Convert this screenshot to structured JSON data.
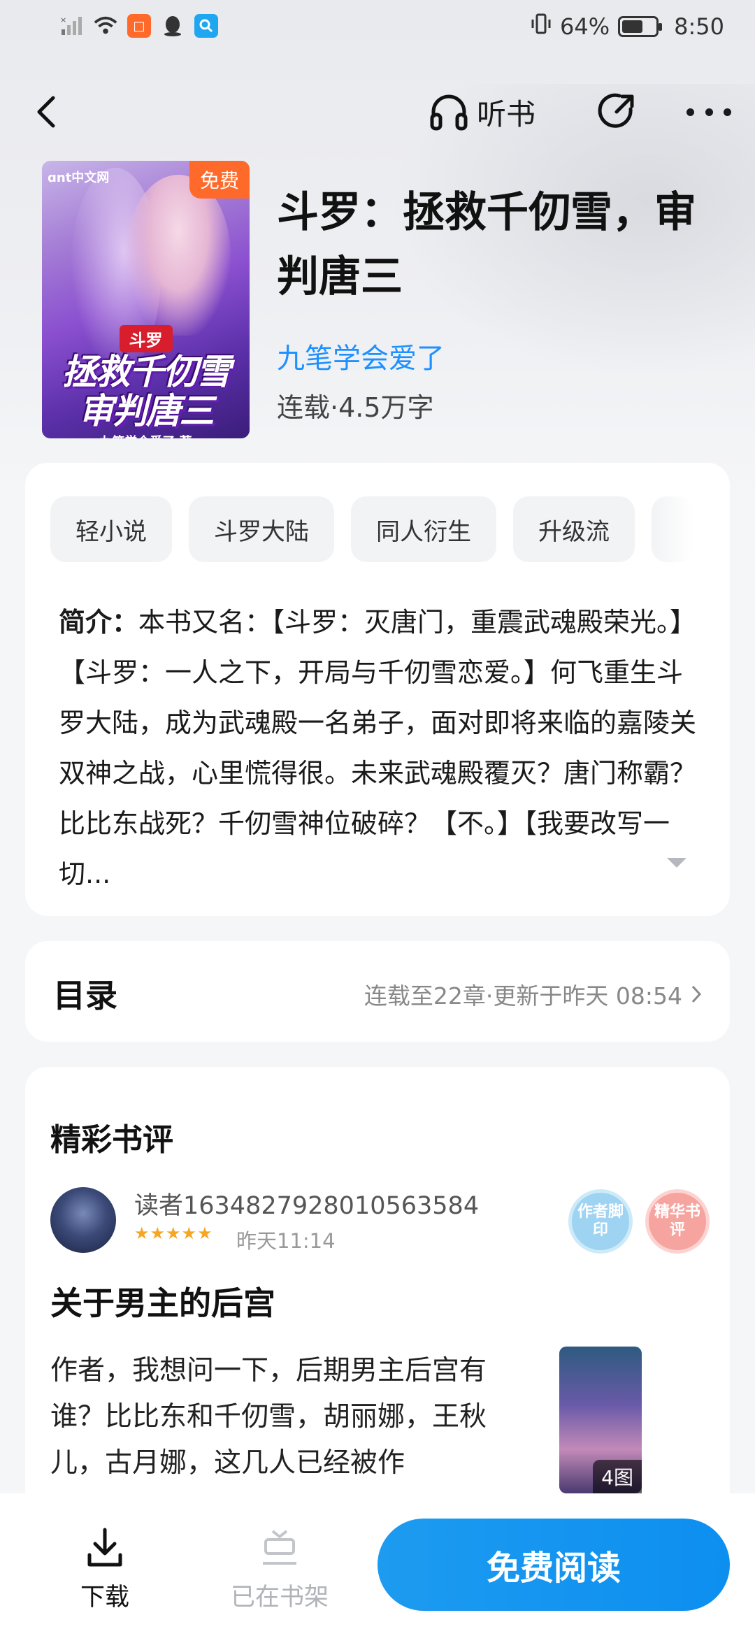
{
  "status_bar": {
    "battery_percent": "64%",
    "battery_level": 0.64,
    "time": "8:50",
    "icons": [
      "signal-icon",
      "wifi-icon",
      "app-notification-icon",
      "qq-icon",
      "search-app-icon",
      "vibrate-icon",
      "battery-icon"
    ]
  },
  "nav": {
    "listen_label": "听书",
    "icons": [
      "back-icon",
      "headphones-icon",
      "share-icon",
      "more-icon"
    ]
  },
  "book": {
    "cover": {
      "free_badge": "免费",
      "publisher": "ɑnt中文网",
      "tag": "斗罗",
      "line1": "拯救千仞雪",
      "line2": "审判唐三",
      "author_line": "九笔学会爱了 著"
    },
    "title": "斗罗：拯救千仞雪，审判唐三",
    "author": "九笔学会爱了",
    "meta": "连载·4.5万字"
  },
  "tags": [
    "轻小说",
    "斗罗大陆",
    "同人衍生",
    "升级流"
  ],
  "intro": {
    "label": "简介：",
    "text": "本书又名：【斗罗：灭唐门，重震武魂殿荣光。】【斗罗：一人之下，开局与千仞雪恋爱。】何飞重生斗罗大陆，成为武魂殿一名弟子，面对即将来临的嘉陵关双神之战，心里慌得很。未来武魂殿覆灭？唐门称霸？比比东战死？千仞雪神位破碎？【不。】【我要改写一切..."
  },
  "toc": {
    "label": "目录",
    "info": "连载至22章·更新于昨天 08:54"
  },
  "reviews": {
    "heading": "精彩书评",
    "items": [
      {
        "user": "读者1634827928010563584",
        "rating": 5,
        "time": "昨天11:14",
        "badges": [
          "作者脚印",
          "精华书评"
        ],
        "title": "关于男主的后宫",
        "body": "作者，我想问一下，后期男主后宫有谁？比比东和千仞雪，胡丽娜，王秋儿，古月娜，这几人已经被作",
        "image_count": "4图"
      }
    ]
  },
  "bottom_bar": {
    "download_label": "下载",
    "shelf_label": "已在书架",
    "read_label": "免费阅读"
  },
  "colors": {
    "accent": "#1d9bf0",
    "author_link": "#1e90ff",
    "free_badge": "#ff6a2b",
    "star": "#f6a623"
  }
}
